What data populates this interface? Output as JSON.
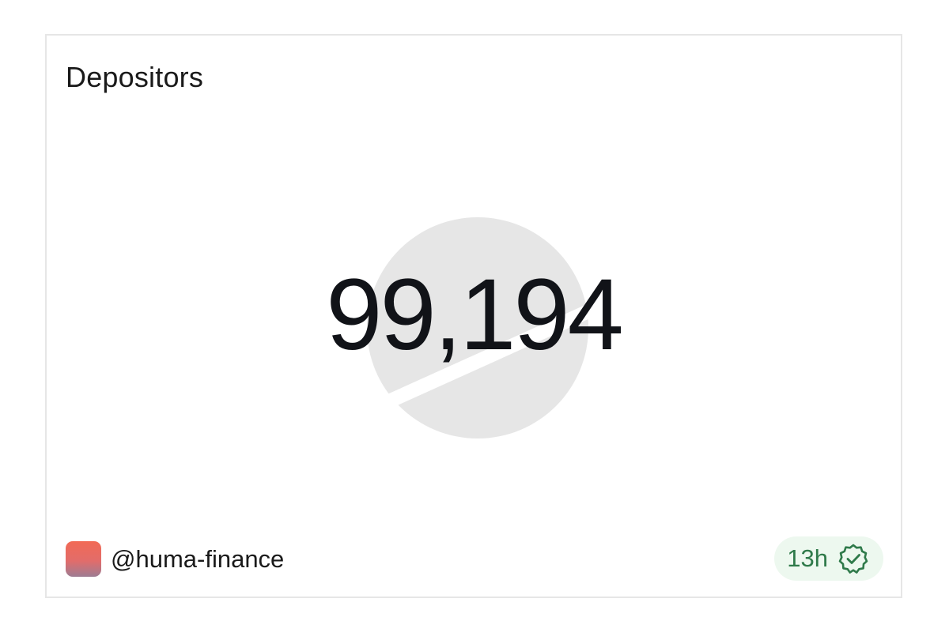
{
  "card": {
    "title": "Depositors",
    "value": "99,194"
  },
  "author": {
    "handle": "@huma-finance",
    "avatar_colors": [
      "#f26a55",
      "#9d7c93"
    ]
  },
  "freshness": {
    "label": "13h",
    "icon": "verified-check-icon",
    "color": "#2f7a4a",
    "background": "#edf8ef"
  },
  "watermark": {
    "icon": "logo-watermark-icon",
    "color": "#e6e6e6"
  }
}
